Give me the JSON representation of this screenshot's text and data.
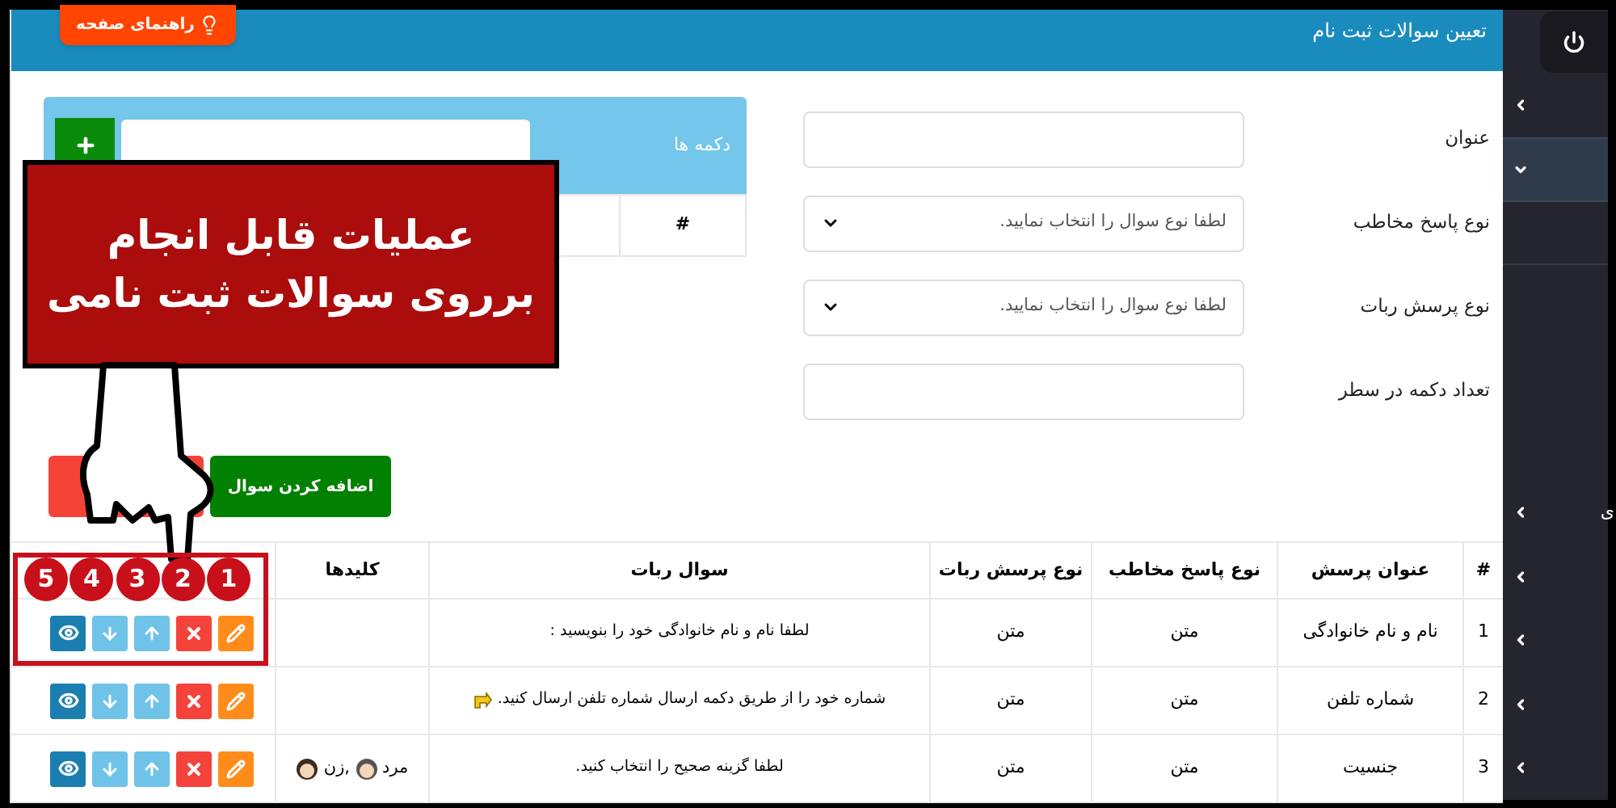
{
  "guide_button": {
    "label": "راهنمای صفحه"
  },
  "page_title": "تعیین سوالات ثبت نام",
  "form": {
    "fields": [
      {
        "label": "عنوان",
        "kind": "text"
      },
      {
        "label": "نوع پاسخ مخاطب",
        "kind": "select",
        "placeholder": "لطفا نوع سوال را انتخاب نمایید."
      },
      {
        "label": "نوع پرسش ربات",
        "kind": "select",
        "placeholder": "لطفا نوع سوال را انتخاب نمایید."
      },
      {
        "label": "تعداد دکمه در سطر",
        "kind": "text"
      }
    ]
  },
  "buttons_panel": {
    "title": "دکمه ها",
    "columns": [
      "#"
    ]
  },
  "add_button": {
    "label": "اضافه کردن سوال"
  },
  "table": {
    "columns": [
      "#",
      "عنوان پرسش",
      "نوع پاسخ مخاطب",
      "نوع پرسش ربات",
      "سوال ربات",
      "کلیدها"
    ],
    "rows": [
      {
        "cells": [
          "1",
          "نام و نام خانوادگی",
          "متن",
          "متن",
          "لطفا نام و نام خانوادگی خود را بنویسید :"
        ],
        "kind": "plain",
        "keys": []
      },
      {
        "cells": [
          "2",
          "شماره تلفن",
          "متن",
          "متن",
          "شماره خود را از طریق دکمه ارسال شماره تلفن ارسال کنید."
        ],
        "kind": "with-icon",
        "keys": []
      },
      {
        "cells": [
          "3",
          "جنسیت",
          "متن",
          "متن",
          "لطفا گزینه صحیح را انتخاب کنید."
        ],
        "kind": "plain",
        "keys": [
          {
            "label": "مرد",
            "kind": "man"
          },
          {
            "label": ",زن",
            "kind": "woman"
          }
        ]
      }
    ]
  },
  "tutorial": {
    "callout": [
      "عملیات قابل انجام",
      "برروی سوالات ثبت نامی"
    ],
    "badges": [
      "1",
      "2",
      "3",
      "4",
      "5"
    ]
  },
  "sidebar": {
    "items": [
      {
        "expanded": false,
        "selected": false
      },
      {
        "expanded": true,
        "selected": true
      },
      {
        "label": "ی",
        "expanded": false,
        "selected": false
      },
      {
        "expanded": false,
        "selected": false
      },
      {
        "expanded": false,
        "selected": false
      },
      {
        "expanded": false,
        "selected": false
      },
      {
        "expanded": false,
        "selected": false
      }
    ]
  }
}
